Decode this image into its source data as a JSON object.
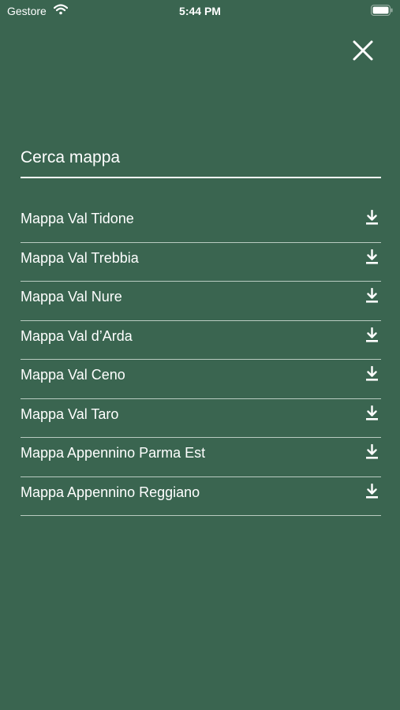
{
  "status_bar": {
    "carrier": "Gestore",
    "time": "5:44 PM",
    "wifi_icon": "wifi-icon",
    "battery_icon": "battery-icon"
  },
  "header": {
    "close_icon": "close-icon"
  },
  "search": {
    "placeholder": "Cerca mappa",
    "value": ""
  },
  "maps": {
    "download_icon": "download-icon",
    "items": [
      {
        "label": "Mappa Val Tidone"
      },
      {
        "label": "Mappa Val Trebbia"
      },
      {
        "label": "Mappa Val Nure"
      },
      {
        "label": "Mappa Val d’Arda"
      },
      {
        "label": "Mappa Val Ceno"
      },
      {
        "label": "Mappa Val Taro"
      },
      {
        "label": "Mappa Appennino Parma Est"
      },
      {
        "label": "Mappa Appennino Reggiano"
      }
    ]
  },
  "colors": {
    "background": "#3a6550",
    "text": "#ffffff",
    "divider": "#b9cbc1"
  }
}
